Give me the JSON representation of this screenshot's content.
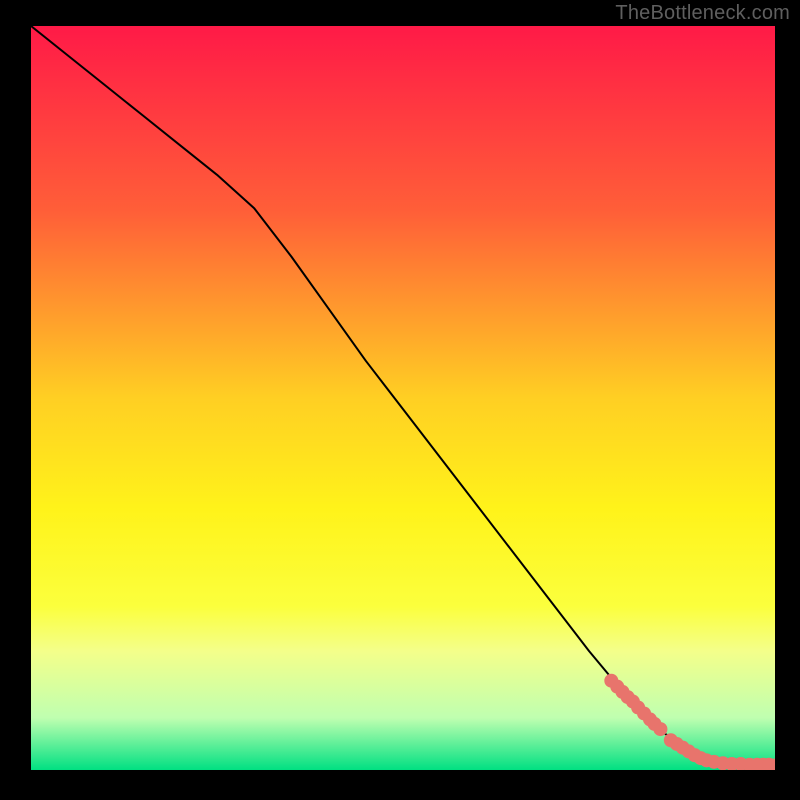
{
  "watermark": "TheBottleneck.com",
  "chart_data": {
    "type": "line",
    "title": "",
    "xlabel": "",
    "ylabel": "",
    "xlim": [
      0,
      100
    ],
    "ylim": [
      0,
      100
    ],
    "background_gradient_stops": [
      {
        "offset": 0.0,
        "color": "#ff1a47"
      },
      {
        "offset": 0.25,
        "color": "#ff5f38"
      },
      {
        "offset": 0.5,
        "color": "#ffcf23"
      },
      {
        "offset": 0.65,
        "color": "#fff31a"
      },
      {
        "offset": 0.78,
        "color": "#fbff3d"
      },
      {
        "offset": 0.84,
        "color": "#f4ff8a"
      },
      {
        "offset": 0.93,
        "color": "#bfffb0"
      },
      {
        "offset": 1.0,
        "color": "#00e082"
      }
    ],
    "series": [
      {
        "name": "bottleneck-curve",
        "color": "#000000",
        "stroke_width": 2,
        "x": [
          0,
          5,
          10,
          15,
          20,
          25,
          30,
          35,
          40,
          45,
          50,
          55,
          60,
          65,
          70,
          75,
          80,
          85,
          90,
          95,
          98,
          100
        ],
        "y": [
          100,
          96,
          92,
          88,
          84,
          80,
          75.5,
          69,
          62,
          55,
          48.5,
          42,
          35.5,
          29,
          22.5,
          16,
          10,
          5,
          2,
          1,
          0.7,
          0.6
        ]
      }
    ],
    "scatter": {
      "name": "sample-points",
      "color": "#e8746c",
      "radius": 7,
      "points": [
        {
          "x": 78.0,
          "y": 12.0
        },
        {
          "x": 78.8,
          "y": 11.2
        },
        {
          "x": 79.5,
          "y": 10.5
        },
        {
          "x": 80.2,
          "y": 9.8
        },
        {
          "x": 80.9,
          "y": 9.2
        },
        {
          "x": 81.6,
          "y": 8.4
        },
        {
          "x": 82.4,
          "y": 7.6
        },
        {
          "x": 83.2,
          "y": 6.8
        },
        {
          "x": 83.8,
          "y": 6.2
        },
        {
          "x": 84.6,
          "y": 5.5
        },
        {
          "x": 86.0,
          "y": 4.0
        },
        {
          "x": 86.8,
          "y": 3.5
        },
        {
          "x": 87.6,
          "y": 3.0
        },
        {
          "x": 88.4,
          "y": 2.5
        },
        {
          "x": 89.2,
          "y": 2.0
        },
        {
          "x": 90.0,
          "y": 1.6
        },
        {
          "x": 90.8,
          "y": 1.3
        },
        {
          "x": 91.8,
          "y": 1.1
        },
        {
          "x": 93.0,
          "y": 0.9
        },
        {
          "x": 94.2,
          "y": 0.8
        },
        {
          "x": 95.4,
          "y": 0.8
        },
        {
          "x": 96.6,
          "y": 0.7
        },
        {
          "x": 97.6,
          "y": 0.7
        },
        {
          "x": 98.4,
          "y": 0.7
        },
        {
          "x": 99.2,
          "y": 0.7
        },
        {
          "x": 100.0,
          "y": 0.6
        }
      ]
    }
  }
}
